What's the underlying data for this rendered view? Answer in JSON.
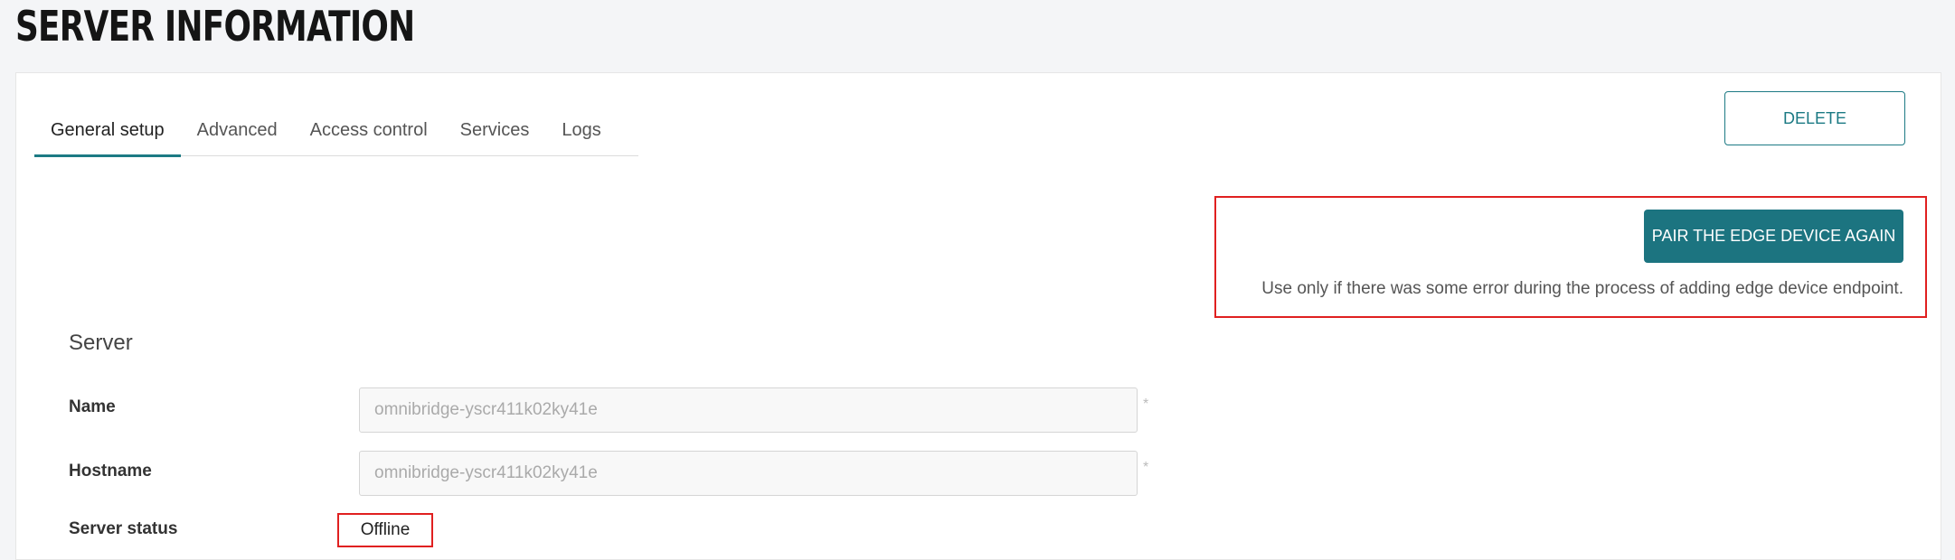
{
  "page": {
    "title": "SERVER INFORMATION"
  },
  "tabs": [
    {
      "label": "General setup",
      "active": true
    },
    {
      "label": "Advanced",
      "active": false
    },
    {
      "label": "Access control",
      "active": false
    },
    {
      "label": "Services",
      "active": false
    },
    {
      "label": "Logs",
      "active": false
    }
  ],
  "actions": {
    "delete_label": "DELETE",
    "pair_label": "PAIR THE EDGE DEVICE AGAIN",
    "pair_note": "Use only if there was some error during the process of adding edge device endpoint."
  },
  "server": {
    "section_title": "Server",
    "name_label": "Name",
    "name_value": "omnibridge-yscr411k02ky41e",
    "hostname_label": "Hostname",
    "hostname_value": "omnibridge-yscr411k02ky41e",
    "status_label": "Server status",
    "status_value": "Offline",
    "required_marker": "*"
  },
  "colors": {
    "accent": "#1c7a84",
    "highlight_border": "#e02020"
  }
}
